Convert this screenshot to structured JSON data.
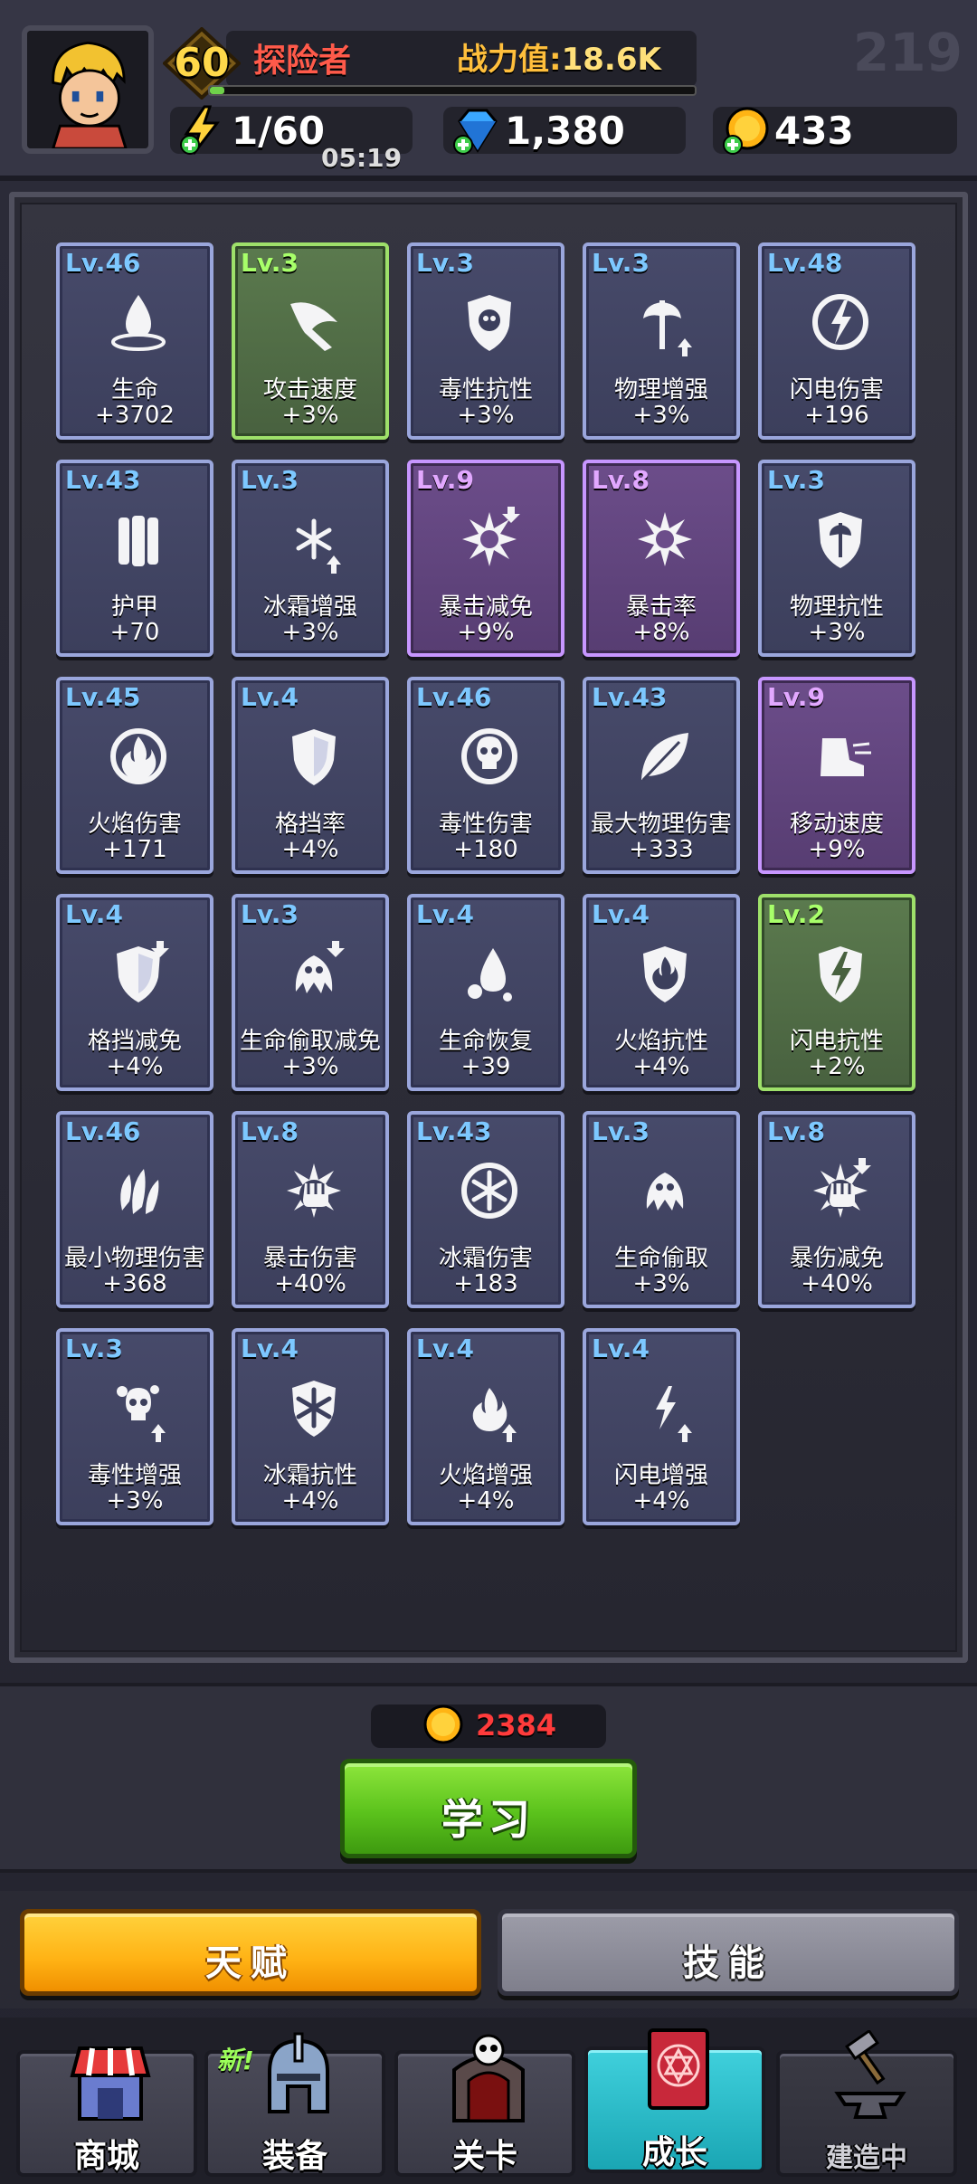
{
  "header": {
    "level": "60",
    "title": "探险者",
    "power_label": "战力值:",
    "power_value": "18.6K",
    "exp_fraction": 0.03,
    "ghost_number": "219",
    "energy": "1/60",
    "energy_timer": "05:19",
    "gems": "1,380",
    "coins": "433"
  },
  "talents": [
    {
      "lv": "Lv.46",
      "name": "生命",
      "value": "+3702",
      "tier": "blue",
      "icon": "water-drop-icon"
    },
    {
      "lv": "Lv.3",
      "name": "攻击速度",
      "value": "+3%",
      "tier": "green",
      "icon": "blade-icon"
    },
    {
      "lv": "Lv.3",
      "name": "毒性抗性",
      "value": "+3%",
      "tier": "blue",
      "icon": "poison-shield-icon"
    },
    {
      "lv": "Lv.3",
      "name": "物理增强",
      "value": "+3%",
      "tier": "blue",
      "icon": "axe-up-icon"
    },
    {
      "lv": "Lv.48",
      "name": "闪电伤害",
      "value": "+196",
      "tier": "blue",
      "icon": "lightning-circle-icon"
    },
    {
      "lv": "Lv.43",
      "name": "护甲",
      "value": "+70",
      "tier": "blue",
      "icon": "armor-icon"
    },
    {
      "lv": "Lv.3",
      "name": "冰霜增强",
      "value": "+3%",
      "tier": "blue",
      "icon": "snowflake-up-icon"
    },
    {
      "lv": "Lv.9",
      "name": "暴击减免",
      "value": "+9%",
      "tier": "purple",
      "icon": "crit-down-icon"
    },
    {
      "lv": "Lv.8",
      "name": "暴击率",
      "value": "+8%",
      "tier": "purple",
      "icon": "crit-icon"
    },
    {
      "lv": "Lv.3",
      "name": "物理抗性",
      "value": "+3%",
      "tier": "blue",
      "icon": "axe-shield-icon"
    },
    {
      "lv": "Lv.45",
      "name": "火焰伤害",
      "value": "+171",
      "tier": "blue",
      "icon": "fire-circle-icon"
    },
    {
      "lv": "Lv.4",
      "name": "格挡率",
      "value": "+4%",
      "tier": "blue",
      "icon": "shield-icon"
    },
    {
      "lv": "Lv.46",
      "name": "毒性伤害",
      "value": "+180",
      "tier": "blue",
      "icon": "skull-circle-icon"
    },
    {
      "lv": "Lv.43",
      "name": "最大物理伤害",
      "value": "+333",
      "tier": "blue",
      "icon": "leaf-icon"
    },
    {
      "lv": "Lv.9",
      "name": "移动速度",
      "value": "+9%",
      "tier": "purple",
      "icon": "boot-icon"
    },
    {
      "lv": "Lv.4",
      "name": "格挡减免",
      "value": "+4%",
      "tier": "blue",
      "icon": "shield-down-icon"
    },
    {
      "lv": "Lv.3",
      "name": "生命偷取减免",
      "value": "+3%",
      "tier": "blue",
      "icon": "vampire-down-icon"
    },
    {
      "lv": "Lv.4",
      "name": "生命恢复",
      "value": "+39",
      "tier": "blue",
      "icon": "drops-icon"
    },
    {
      "lv": "Lv.4",
      "name": "火焰抗性",
      "value": "+4%",
      "tier": "blue",
      "icon": "fire-shield-icon"
    },
    {
      "lv": "Lv.2",
      "name": "闪电抗性",
      "value": "+2%",
      "tier": "green",
      "icon": "lightning-shield-icon"
    },
    {
      "lv": "Lv.46",
      "name": "最小物理伤害",
      "value": "+368",
      "tier": "blue",
      "icon": "claw-icon"
    },
    {
      "lv": "Lv.8",
      "name": "暴击伤害",
      "value": "+40%",
      "tier": "blue",
      "icon": "fist-burst-icon"
    },
    {
      "lv": "Lv.43",
      "name": "冰霜伤害",
      "value": "+183",
      "tier": "blue",
      "icon": "snowflake-circle-icon"
    },
    {
      "lv": "Lv.3",
      "name": "生命偷取",
      "value": "+3%",
      "tier": "blue",
      "icon": "vampire-icon"
    },
    {
      "lv": "Lv.8",
      "name": "暴伤减免",
      "value": "+40%",
      "tier": "blue",
      "icon": "fist-down-icon"
    },
    {
      "lv": "Lv.3",
      "name": "毒性增强",
      "value": "+3%",
      "tier": "blue",
      "icon": "skull-up-icon"
    },
    {
      "lv": "Lv.4",
      "name": "冰霜抗性",
      "value": "+4%",
      "tier": "blue",
      "icon": "snowflake-shield-icon"
    },
    {
      "lv": "Lv.4",
      "name": "火焰增强",
      "value": "+4%",
      "tier": "blue",
      "icon": "fire-up-icon"
    },
    {
      "lv": "Lv.4",
      "name": "闪电增强",
      "value": "+4%",
      "tier": "blue",
      "icon": "lightning-up-icon"
    }
  ],
  "learn": {
    "cost": "2384",
    "button_label": "学习"
  },
  "tabs": {
    "talent_label": "天赋",
    "skill_label": "技能"
  },
  "nav": {
    "shop_label": "商城",
    "equip_label": "装备",
    "equip_new": "新!",
    "stage_label": "关卡",
    "growth_label": "成长",
    "build_label": "建造中"
  },
  "colors": {
    "blue_border": "#9aa6dc",
    "green_border": "#9ee06a",
    "purple_border": "#c796ff",
    "accent_gold": "#ffb214",
    "learn_green": "#5bc21c"
  }
}
